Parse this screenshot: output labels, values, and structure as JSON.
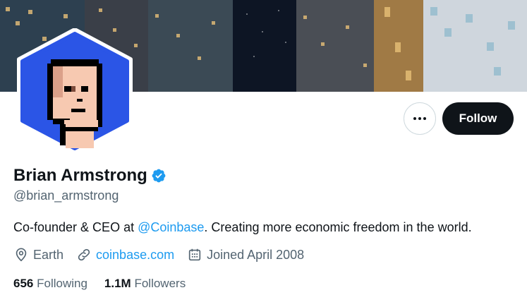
{
  "profile": {
    "display_name": "Brian Armstrong",
    "handle": "@brian_armstrong",
    "verified": true,
    "bio": {
      "before": "Co-founder & CEO at ",
      "mention": "@Coinbase",
      "after": ". Creating more economic freedom in the world."
    },
    "location": "Earth",
    "website": "coinbase.com",
    "joined": "Joined April 2008"
  },
  "actions": {
    "follow_label": "Follow"
  },
  "stats": {
    "following_count": "656",
    "following_label": "Following",
    "followers_count": "1.1M",
    "followers_label": "Followers"
  },
  "colors": {
    "accent": "#1d9bf0",
    "avatar_bg": "#2b55e6",
    "follow_bg": "#0f1419"
  },
  "icons": {
    "location": "map-pin-icon",
    "website": "link-icon",
    "joined": "calendar-icon",
    "more": "ellipsis-icon",
    "verified": "verified-badge-icon"
  }
}
